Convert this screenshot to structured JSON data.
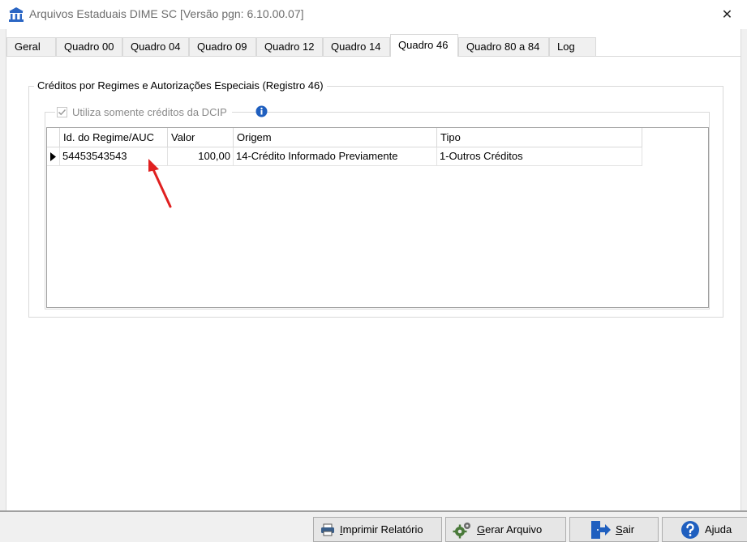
{
  "window": {
    "title": "Arquivos Estaduais DIME SC [Versão pgn: 6.10.00.07]",
    "close_symbol": "✕"
  },
  "tabs": [
    {
      "label": "Geral"
    },
    {
      "label": "Quadro 00"
    },
    {
      "label": "Quadro 04"
    },
    {
      "label": "Quadro 09"
    },
    {
      "label": "Quadro 12"
    },
    {
      "label": "Quadro 14"
    },
    {
      "label": "Quadro 46",
      "active": true
    },
    {
      "label": "Quadro 80 a 84"
    },
    {
      "label": "Log"
    }
  ],
  "group": {
    "title": "Créditos por Regimes e Autorizações Especiais (Registro 46)",
    "dcip_checkbox_label": "Utiliza somente créditos da DCIP",
    "dcip_checked": true
  },
  "grid": {
    "columns": [
      "Id. do Regime/AUC",
      "Valor",
      "Origem",
      "Tipo"
    ],
    "rows": [
      {
        "id": "54453543543",
        "valor": "100,00",
        "origem": "14-Crédito Informado Previamente",
        "tipo": "1-Outros Créditos"
      }
    ]
  },
  "buttons": {
    "print": {
      "mnemonic": "I",
      "rest": "mprimir Relatório"
    },
    "generate": {
      "mnemonic": "G",
      "rest": "erar Arquivo"
    },
    "exit": {
      "mnemonic": "S",
      "rest": "air"
    },
    "help": {
      "mnemonic": "",
      "rest": "Ajuda"
    }
  },
  "colors": {
    "accent": "#1f5fbf",
    "annotation_arrow": "#e02020"
  },
  "icons": {
    "app": "building-icon",
    "info": "info-icon",
    "print": "printer-icon",
    "generate": "gears-icon",
    "exit": "exit-door-icon",
    "help": "help-icon"
  }
}
